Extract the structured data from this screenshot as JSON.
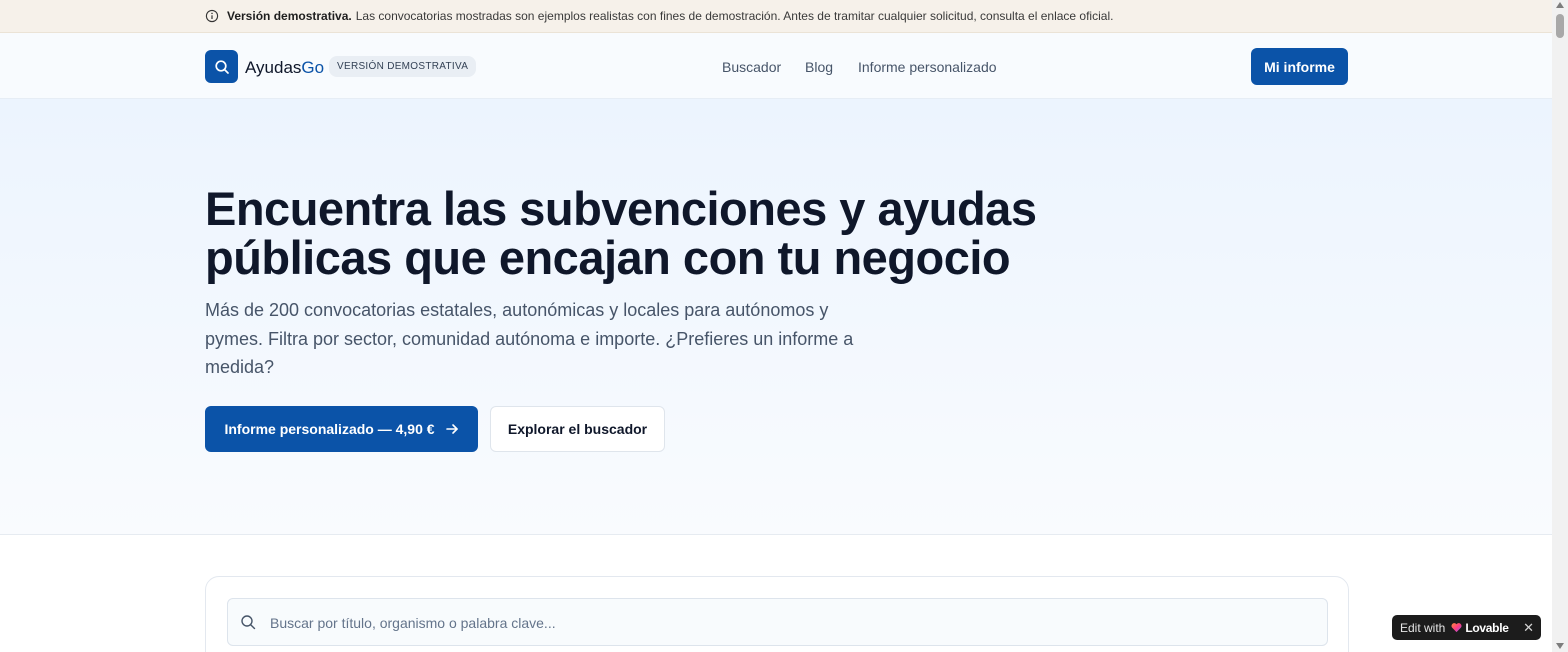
{
  "banner": {
    "icon": "info-icon",
    "strong": "Versión demostrativa.",
    "text": "Las convocatorias mostradas son ejemplos realistas con fines de demostración. Antes de tramitar cualquier solicitud, consulta el enlace oficial."
  },
  "header": {
    "brand_main": "Ayudas",
    "brand_accent": "Go",
    "badge": "VERSIÓN DEMOSTRATIVA",
    "nav": [
      "Buscador",
      "Blog",
      "Informe personalizado"
    ],
    "cta": "Mi informe"
  },
  "hero": {
    "title": "Encuentra las subvenciones y ayudas públicas que encajan con tu negocio",
    "subtitle": "Más de 200 convocatorias estatales, autonómicas y locales para autónomos y pymes. Filtra por sector, comunidad autónoma e importe. ¿Prefieres un informe a medida?",
    "primary_button": "Informe personalizado — 4,90 €",
    "secondary_button": "Explorar el buscador"
  },
  "search": {
    "placeholder": "Buscar por título, organismo o palabra clave...",
    "value": ""
  },
  "lovable": {
    "edit_label": "Edit with",
    "brand": "Lovable",
    "close": "✕"
  },
  "colors": {
    "primary": "#0b53a8",
    "banner_bg": "#f6f1ea",
    "hero_bg": "#ecf4fe",
    "text": "#0f172a",
    "muted": "#475569"
  }
}
